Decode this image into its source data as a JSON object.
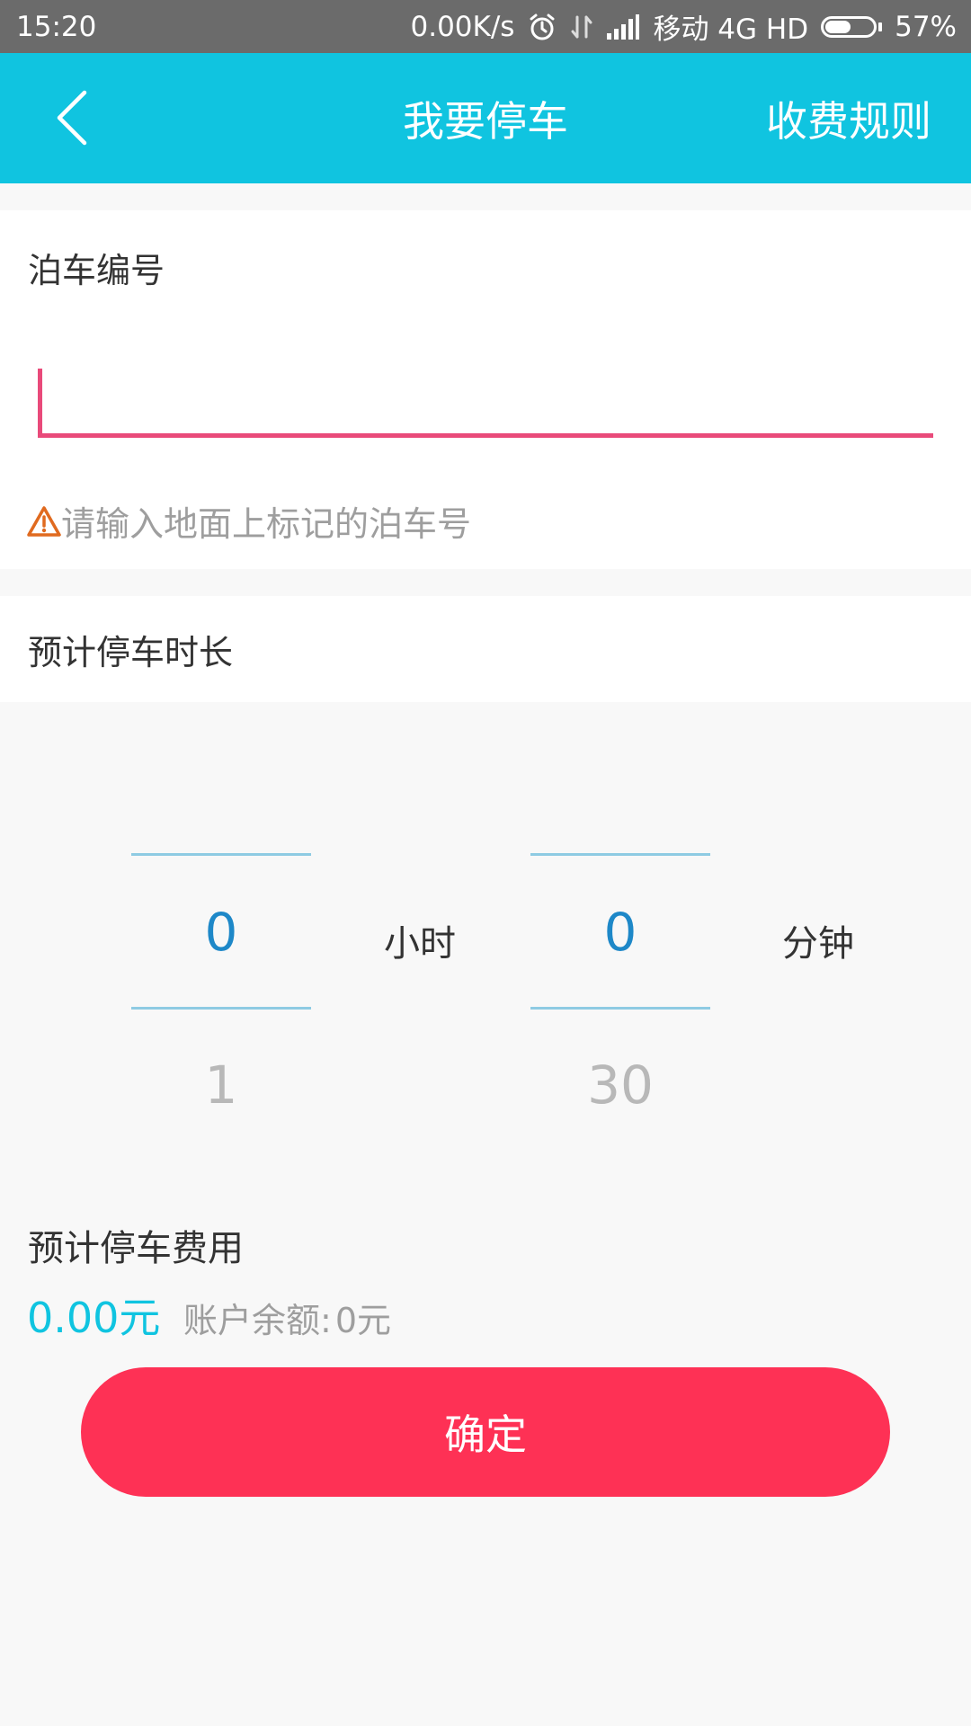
{
  "status_bar": {
    "time": "15:20",
    "network_speed": "0.00K/s",
    "carrier": "移动 4G HD",
    "battery_percent": "57%",
    "battery_level": 0.57,
    "icons": [
      "alarm-icon",
      "data-transfer-icon",
      "signal-icon",
      "battery-icon"
    ]
  },
  "header": {
    "title": "我要停车",
    "rules_link": "收费规则",
    "back_icon": "chevron-left-icon",
    "color": "#10c4e0"
  },
  "parking_number": {
    "label": "泊车编号",
    "value": "",
    "hint": "请输入地面上标记的泊车号",
    "hint_icon": "warning-icon",
    "accent_color": "#e94a7a"
  },
  "duration": {
    "label": "预计停车时长",
    "hours": {
      "selected": "0",
      "next": "1",
      "unit": "小时"
    },
    "minutes": {
      "selected": "0",
      "next": "30",
      "unit": "分钟"
    }
  },
  "fee": {
    "label": "预计停车费用",
    "amount": "0.00元",
    "balance_label": "账户余额:",
    "balance_value": "0元"
  },
  "confirm": {
    "label": "确定",
    "color": "#fe3155"
  }
}
